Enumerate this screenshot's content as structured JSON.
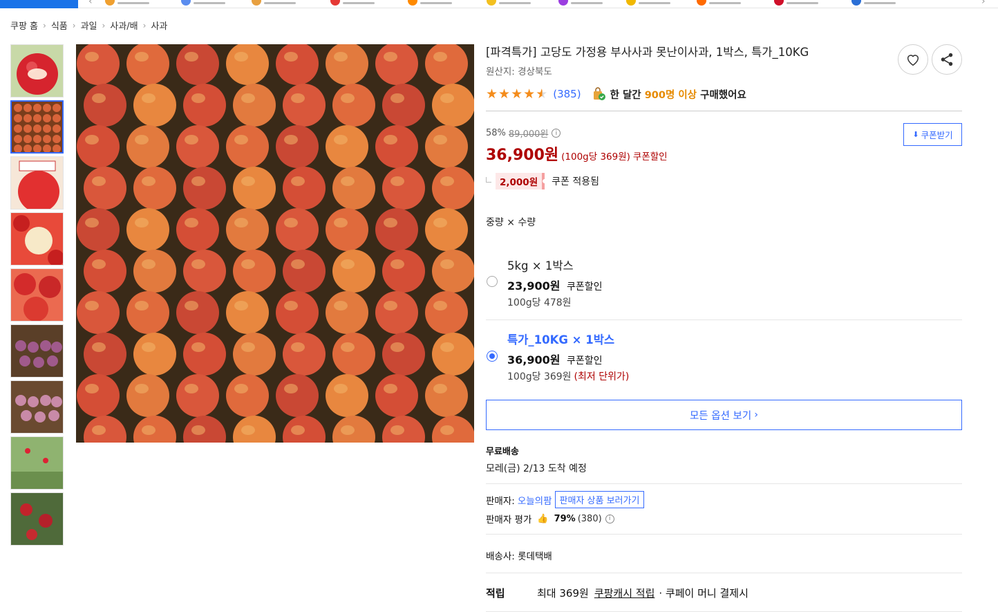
{
  "breadcrumb": [
    "쿠팡 홈",
    "식품",
    "과일",
    "사과/배",
    "사과"
  ],
  "product": {
    "title": "[파격특가] 고당도 가정용 부사사과 못난이사과, 1박스, 특가_10KG",
    "origin": "원산지: 경상북도",
    "review_count": "(385)",
    "rating": 4.5,
    "buy_prefix": "한 달간",
    "buy_highlight": "900명 이상",
    "buy_suffix": "구매했어요"
  },
  "price": {
    "discount_rate": "58%",
    "original": "89,000원",
    "sale": "36,900원",
    "unit": "(100g당 369원)",
    "coupon_label": "쿠폰할인",
    "coupon_amount": "2,000원",
    "coupon_applied_text": "쿠폰 적용됨",
    "coupon_button": "쿠폰받기"
  },
  "options": {
    "heading": "중량 × 수량",
    "items": [
      {
        "name": "5kg × 1박스",
        "price": "23,900원",
        "coupon": "쿠폰할인",
        "unit": "100g당 478원",
        "note": "",
        "selected": false
      },
      {
        "name": "특가_10KG × 1박스",
        "price": "36,900원",
        "coupon": "쿠폰할인",
        "unit": "100g당 369원",
        "note": "(최저 단위가)",
        "selected": true
      }
    ],
    "all_button": "모든 옵션 보기"
  },
  "shipping": {
    "label": "무료배송",
    "date": "모레(금) 2/13 도착 예정"
  },
  "seller": {
    "label": "판매자:",
    "name": "오늘의팜",
    "button": "판매자 상품 보러가기",
    "rating_label": "판매자 평가",
    "rating_pct": "79%",
    "rating_count": "(380)"
  },
  "carrier": "배송사:  롯데택배",
  "cashback": {
    "label": "적립",
    "amount": "최대 369원",
    "link": "쿠팡캐시 적립",
    "suffix": "· 쿠페이 머니 결제시"
  },
  "colors": {
    "accent": "#346aff",
    "price": "#ae0000",
    "star": "#f48c1b"
  }
}
